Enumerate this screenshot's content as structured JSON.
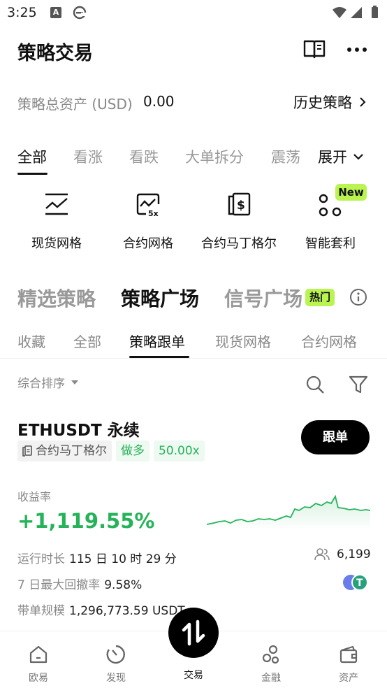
{
  "status_bar": {
    "time": "3:25",
    "a_icon_letter": "A"
  },
  "header": {
    "title": "策略交易"
  },
  "assets": {
    "label": "策略总资产 (USD)",
    "value": "0.00",
    "history_link": "历史策略"
  },
  "category_tabs": {
    "items": [
      "全部",
      "看涨",
      "看跌",
      "大单拆分",
      "震荡"
    ],
    "active_index": 0,
    "expand_label": "展开"
  },
  "grid_items": [
    {
      "label": "现货网格",
      "icon": "spot-grid-icon"
    },
    {
      "label": "合约网格",
      "icon": "futures-grid-icon",
      "icon_text": "5x"
    },
    {
      "label": "合约马丁格尔",
      "icon": "martingale-icon",
      "icon_text": "$"
    },
    {
      "label": "智能套利",
      "icon": "smart-arbitrage-icon"
    }
  ],
  "new_badge": "New",
  "section_tabs": {
    "items": [
      "精选策略",
      "策略广场",
      "信号广场"
    ],
    "active_index": 1,
    "hot_badge": "热门"
  },
  "sub_tabs": {
    "items": [
      "收藏",
      "全部",
      "策略跟单",
      "现货网格",
      "合约网格"
    ],
    "active_index": 2
  },
  "filter": {
    "sort_label": "综合排序"
  },
  "card": {
    "title": "ETHUSDT 永续",
    "copy_button": "跟单",
    "tags": [
      "合约马丁格尔",
      "做多",
      "50.00x"
    ],
    "yield_label": "收益率",
    "yield_value": "+1,119.55%",
    "runtime_label": "运行时长",
    "runtime_value": "115 日 10 时 29 分",
    "drawdown_label": "7 日最大回撤率",
    "drawdown_value": "9.58%",
    "scale_label": "带单规模",
    "scale_value": "1,296,773.59 USDT",
    "followers": "6,199",
    "coin_symbol": "T",
    "accent_color": "#25b35a"
  },
  "bottom_nav": {
    "items": [
      "欧易",
      "发现",
      "交易",
      "金融",
      "资产"
    ],
    "active_index": 2
  }
}
